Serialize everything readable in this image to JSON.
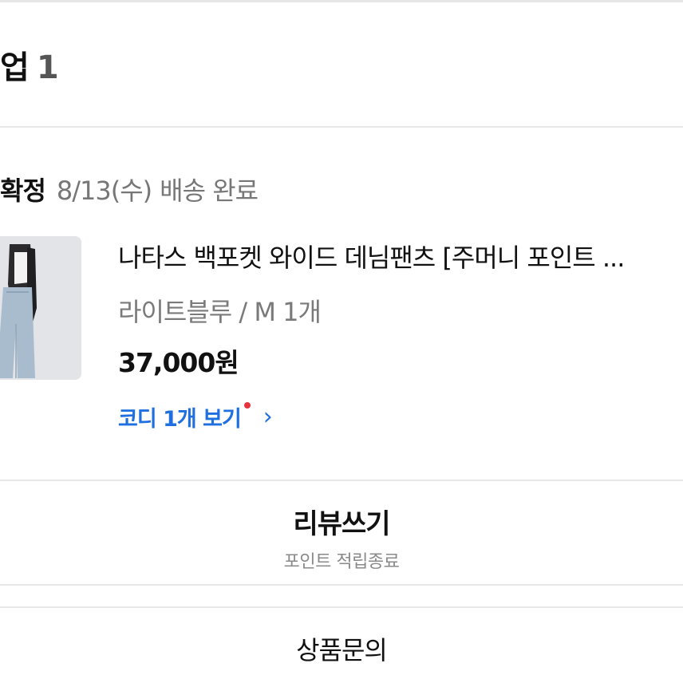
{
  "section": {
    "title": "업",
    "count": "1"
  },
  "order": {
    "status": "확정",
    "date": "8/13(수)",
    "delivery": "배송 완료"
  },
  "product": {
    "name": "나타스 백포켓 와이드 데님팬츠 [주머니 포인트 ...",
    "option": "라이트블루 / M 1개",
    "price": "37,000원",
    "coordi_link": "코디 1개 보기",
    "chevron": "›"
  },
  "review": {
    "label": "리뷰쓰기",
    "sub": "포인트 적립종료"
  },
  "inquiry": {
    "label": "상품문의"
  },
  "colors": {
    "link": "#1f6fe0",
    "badge_dot": "#e8323c"
  },
  "icons": {
    "chevron": "chevron-right-icon",
    "dot": "new-badge-dot"
  }
}
